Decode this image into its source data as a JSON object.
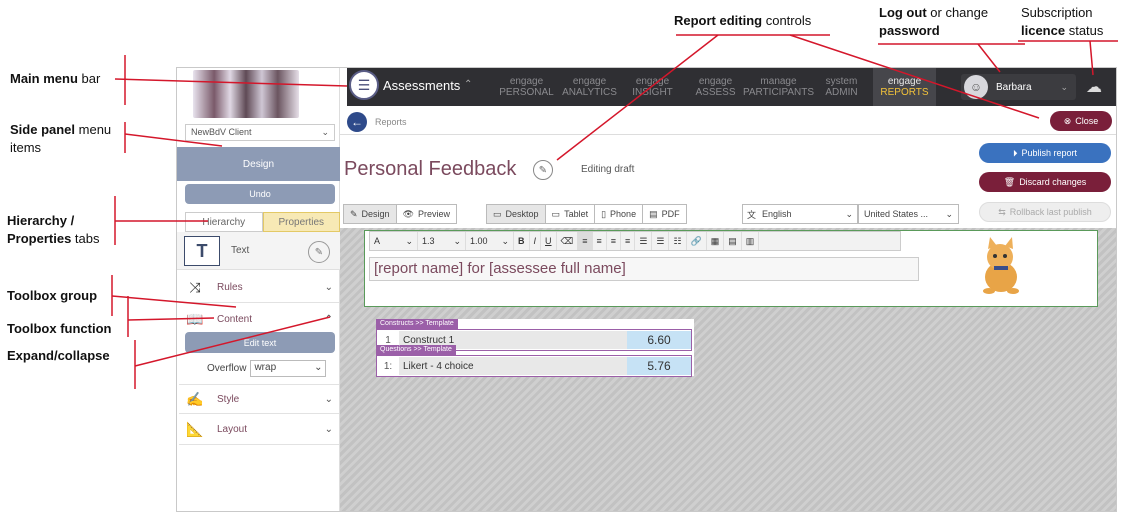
{
  "annotations": {
    "main_menu": [
      "Main menu",
      " bar"
    ],
    "side_panel": [
      "Side panel",
      " menu",
      "items"
    ],
    "hier_props": [
      "Hierarchy /",
      "Properties",
      " tabs"
    ],
    "toolbox_group": "Toolbox group",
    "toolbox_function": "Toolbox function",
    "expand_collapse": "Expand/collapse",
    "report_editing": [
      "Report editing",
      "  controls"
    ],
    "logout": [
      "Log out",
      " or change",
      "password"
    ],
    "subscription": [
      "Subscription",
      "licence",
      "  status"
    ]
  },
  "topbar": {
    "app_title": "Assessments",
    "nav": [
      {
        "l1": "engage",
        "l2": "PERSONAL",
        "active": false
      },
      {
        "l1": "engage",
        "l2": "ANALYTICS",
        "active": false
      },
      {
        "l1": "engage",
        "l2": "INSIGHT",
        "active": false
      },
      {
        "l1": "engage",
        "l2": "ASSESS",
        "active": false
      },
      {
        "l1": "manage",
        "l2": "PARTICIPANTS",
        "active": false
      },
      {
        "l1": "system",
        "l2": "ADMIN",
        "active": false
      },
      {
        "l1": "engage",
        "l2": "REPORTS",
        "active": true
      }
    ],
    "user_name": "Barbara"
  },
  "sidebar": {
    "client": "NewBdV Client",
    "design_label": "Design",
    "undo_label": "Undo",
    "tab_hierarchy": "Hierarchy",
    "tab_properties": "Properties",
    "text_label": "Text",
    "rules_label": "Rules",
    "content_label": "Content",
    "edit_text_label": "Edit text",
    "overflow_label": "Overflow",
    "overflow_value": "wrap",
    "style_label": "Style",
    "layout_label": "Layout"
  },
  "main": {
    "crumb": "Reports",
    "close_label": "Close",
    "page_title": "Personal Feedback",
    "draft_label": "Editing draft",
    "publish_label": "Publish report",
    "discard_label": "Discard changes",
    "rollback_label": "Rollback last publish",
    "design_label": "Design",
    "preview_label": "Preview",
    "desktop_label": "Desktop",
    "tablet_label": "Tablet",
    "phone_label": "Phone",
    "pdf_label": "PDF",
    "language": "English",
    "locale": "United States ...",
    "line_height": "1.3",
    "spacing": "1.00",
    "text_value": "[report name] for [assessee full name]",
    "tag1": "Constructs >> Template",
    "row1": {
      "idx": "1",
      "name": "Construct 1",
      "value": "6.60"
    },
    "tag2": "Questions >> Template",
    "row2": {
      "idx": "1:",
      "name": "Likert - 4 choice",
      "value": "5.76"
    }
  }
}
